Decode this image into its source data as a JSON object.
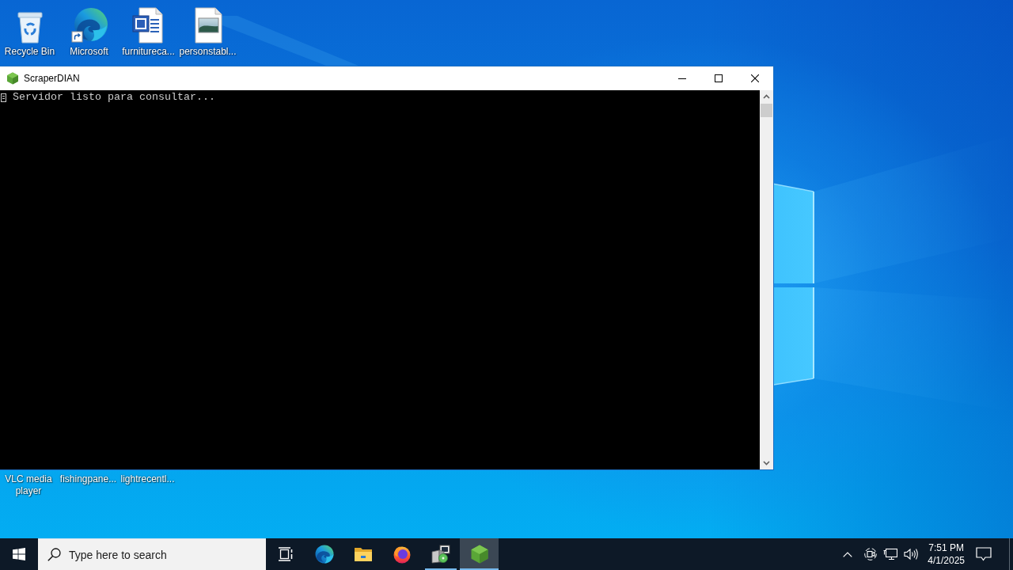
{
  "desktop": {
    "icons": [
      {
        "label": "Recycle Bin",
        "kind": "recycle-bin"
      },
      {
        "label": "Microsoft",
        "kind": "browser"
      },
      {
        "label": "furnitureca...",
        "kind": "word-document"
      },
      {
        "label": "personstabl...",
        "kind": "image-file"
      }
    ],
    "partly_covered_icons": [
      {
        "label": "VLC media player"
      },
      {
        "label": "fishingpane..."
      },
      {
        "label": "lightrecentl..."
      }
    ]
  },
  "window": {
    "title": "ScraperDIAN",
    "console_lines": [
      {
        "text": "Servidor listo para consultar...",
        "glyph_box": true
      }
    ]
  },
  "taskbar": {
    "search": {
      "placeholder": "Type here to search"
    },
    "apps": [
      {
        "kind": "task-view",
        "running": false,
        "selected": false
      },
      {
        "kind": "browser",
        "running": false,
        "selected": false
      },
      {
        "kind": "folder",
        "running": false,
        "selected": false
      },
      {
        "kind": "fox-browser",
        "running": false,
        "selected": false
      },
      {
        "kind": "installer",
        "running": true,
        "selected": false
      },
      {
        "kind": "hexagon-app",
        "running": true,
        "selected": true
      }
    ],
    "clock": {
      "time": "7:51 PM",
      "date": "4/1/2025"
    }
  }
}
